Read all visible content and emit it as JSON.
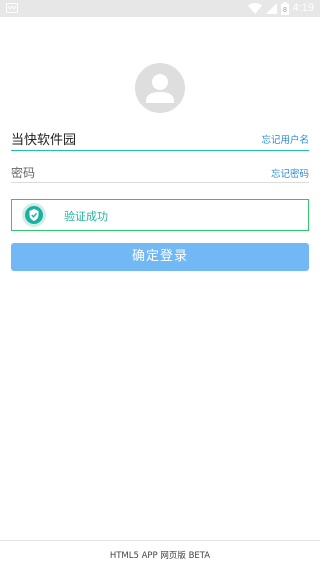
{
  "status_bar": {
    "time": "4:19",
    "battery_level_label": "8",
    "icons": [
      "notification-icon",
      "wifi-icon",
      "signal-icon",
      "battery-icon"
    ]
  },
  "login": {
    "username_value": "当快软件园",
    "forgot_username_label": "忘记用户名",
    "password_placeholder": "密码",
    "forgot_password_label": "忘记密码",
    "verify_text": "验证成功",
    "submit_label": "确定登录"
  },
  "footer": {
    "text": "HTML5 APP 网页版 BETA"
  },
  "colors": {
    "accent": "#2a8bd6",
    "button": "#72b8f4",
    "success_border": "#31c56c",
    "success_text": "#20b59c"
  }
}
